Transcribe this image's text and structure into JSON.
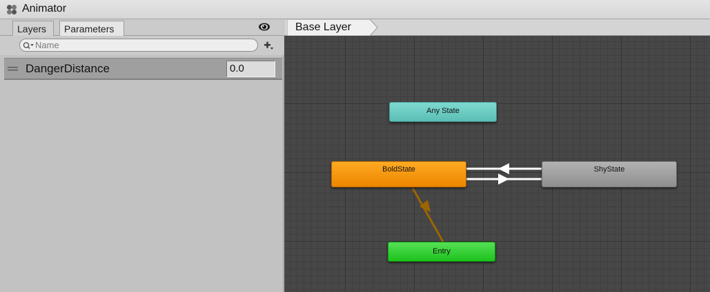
{
  "window": {
    "title": "Animator",
    "icon": "animator-icon"
  },
  "left_panel": {
    "tabs": [
      {
        "label": "Layers"
      },
      {
        "label": "Parameters",
        "active": true
      }
    ],
    "search": {
      "placeholder": "Name",
      "value": ""
    },
    "parameters": [
      {
        "name": "DangerDistance",
        "type": "float",
        "value": "0.0"
      }
    ]
  },
  "graph": {
    "breadcrumb": "Base Layer",
    "states": {
      "any_state": {
        "label": "Any State",
        "color": "#66c8c0"
      },
      "bold_state": {
        "label": "BoldState",
        "color": "#f59200"
      },
      "shy_state": {
        "label": "ShyState",
        "color": "#9f9f9f"
      },
      "entry": {
        "label": "Entry",
        "color": "#2ccc2c"
      }
    },
    "transitions": [
      {
        "from": "entry",
        "to": "bold_state",
        "color": "#9b6500"
      },
      {
        "from": "shy_state",
        "to": "bold_state",
        "color": "#ffffff"
      },
      {
        "from": "bold_state",
        "to": "shy_state",
        "color": "#ffffff"
      }
    ]
  }
}
